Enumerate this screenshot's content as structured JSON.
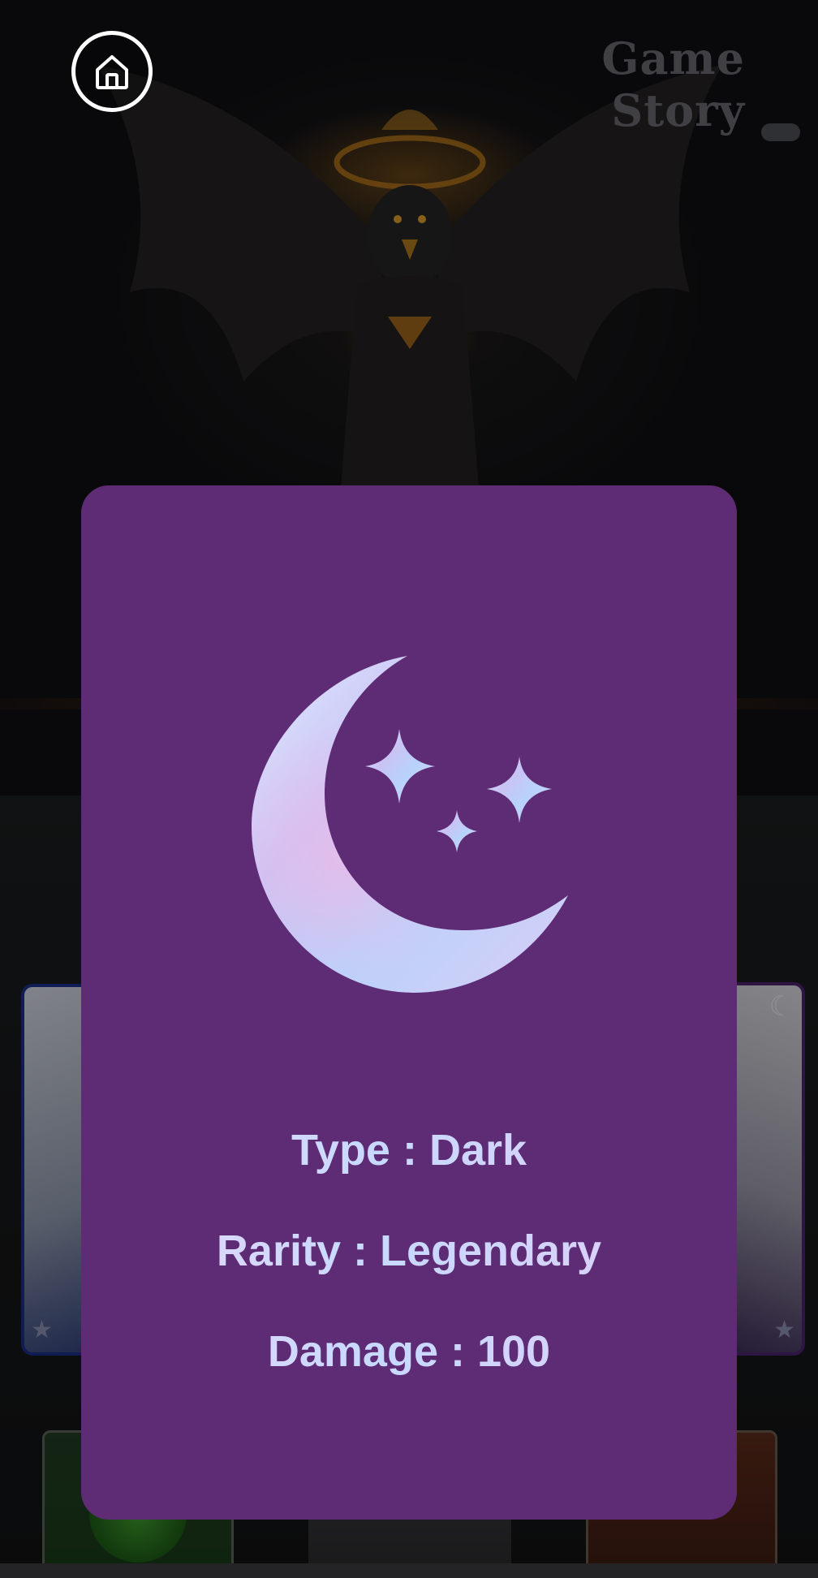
{
  "header": {
    "title": "Game Story",
    "home_icon": "home-icon"
  },
  "card_detail": {
    "emblem_icon": "crescent-moon-stars-icon",
    "background_color": "#5e2b75",
    "text_color": "#cfd3ff",
    "stats": [
      {
        "label": "Type",
        "separator": " : ",
        "value": "Dark"
      },
      {
        "label": "Rarity",
        "separator": " : ",
        "value": "Legendary"
      },
      {
        "label": "Damage",
        "separator": " : ",
        "value": "100"
      }
    ]
  },
  "background": {
    "left_card_icon": "star-icon",
    "right_card_icons": [
      "crescent-moon-icon",
      "star-icon"
    ]
  }
}
